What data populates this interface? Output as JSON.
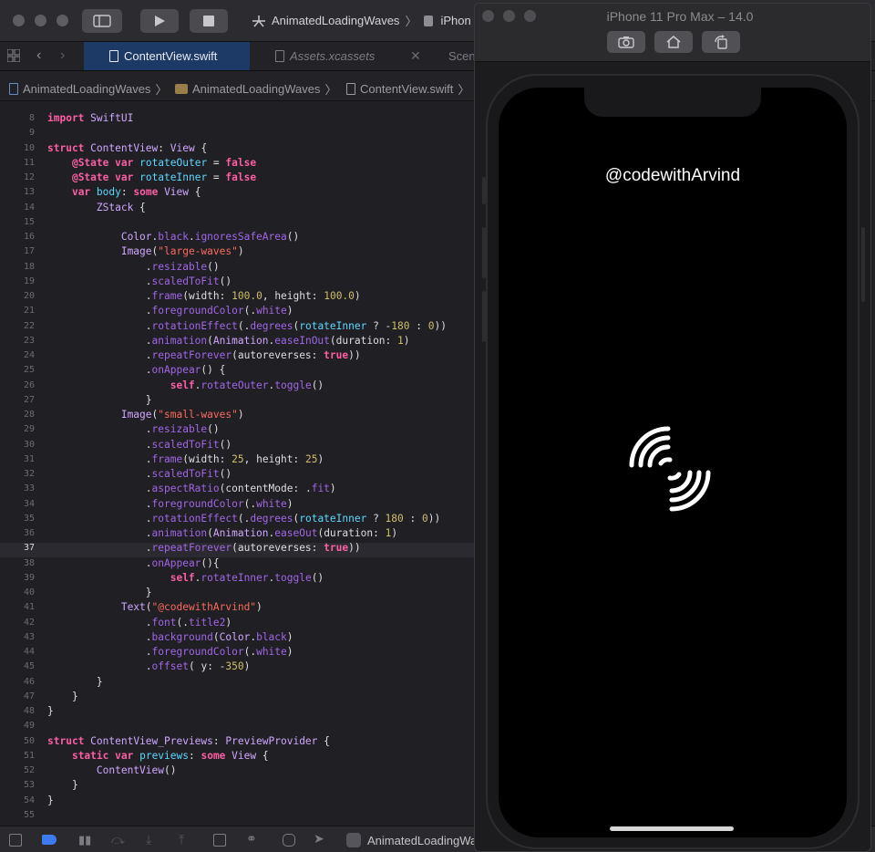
{
  "toolbar": {
    "scheme_project": "AnimatedLoadingWaves",
    "scheme_device": "iPhon"
  },
  "tabs": [
    {
      "label": "ContentView.swift",
      "active": true
    },
    {
      "label": "Assets.xcassets",
      "active": false
    },
    {
      "label": "Scen",
      "active": false
    }
  ],
  "breadcrumb": [
    "AnimatedLoadingWaves",
    "AnimatedLoadingWaves",
    "ContentView.swift"
  ],
  "editor": {
    "current_line": 37,
    "lines": [
      {
        "n": 8,
        "text": "import SwiftUI"
      },
      {
        "n": 9,
        "text": ""
      },
      {
        "n": 10,
        "text": "struct ContentView: View {"
      },
      {
        "n": 11,
        "text": "    @State var rotateOuter = false"
      },
      {
        "n": 12,
        "text": "    @State var rotateInner = false"
      },
      {
        "n": 13,
        "text": "    var body: some View {"
      },
      {
        "n": 14,
        "text": "        ZStack {"
      },
      {
        "n": 15,
        "text": ""
      },
      {
        "n": 16,
        "text": "            Color.black.ignoresSafeArea()"
      },
      {
        "n": 17,
        "text": "            Image(\"large-waves\")"
      },
      {
        "n": 18,
        "text": "                .resizable()"
      },
      {
        "n": 19,
        "text": "                .scaledToFit()"
      },
      {
        "n": 20,
        "text": "                .frame(width: 100.0, height: 100.0)"
      },
      {
        "n": 21,
        "text": "                .foregroundColor(.white)"
      },
      {
        "n": 22,
        "text": "                .rotationEffect(.degrees(rotateInner ? -180 : 0))"
      },
      {
        "n": 23,
        "text": "                .animation(Animation.easeInOut(duration: 1)"
      },
      {
        "n": 24,
        "text": "                .repeatForever(autoreverses: true))"
      },
      {
        "n": 25,
        "text": "                .onAppear() {"
      },
      {
        "n": 26,
        "text": "                    self.rotateOuter.toggle()"
      },
      {
        "n": 27,
        "text": "                }"
      },
      {
        "n": 28,
        "text": "            Image(\"small-waves\")"
      },
      {
        "n": 29,
        "text": "                .resizable()"
      },
      {
        "n": 30,
        "text": "                .scaledToFit()"
      },
      {
        "n": 31,
        "text": "                .frame(width: 25, height: 25)"
      },
      {
        "n": 32,
        "text": "                .scaledToFit()"
      },
      {
        "n": 33,
        "text": "                .aspectRatio(contentMode: .fit)"
      },
      {
        "n": 34,
        "text": "                .foregroundColor(.white)"
      },
      {
        "n": 35,
        "text": "                .rotationEffect(.degrees(rotateInner ? 180 : 0))"
      },
      {
        "n": 36,
        "text": "                .animation(Animation.easeOut(duration: 1)"
      },
      {
        "n": 37,
        "text": "                .repeatForever(autoreverses: true))"
      },
      {
        "n": 38,
        "text": "                .onAppear(){"
      },
      {
        "n": 39,
        "text": "                    self.rotateInner.toggle()"
      },
      {
        "n": 40,
        "text": "                }"
      },
      {
        "n": 41,
        "text": "            Text(\"@codewithArvind\")"
      },
      {
        "n": 42,
        "text": "                .font(.title2)"
      },
      {
        "n": 43,
        "text": "                .background(Color.black)"
      },
      {
        "n": 44,
        "text": "                .foregroundColor(.white)"
      },
      {
        "n": 45,
        "text": "                .offset( y: -350)"
      },
      {
        "n": 46,
        "text": "        }"
      },
      {
        "n": 47,
        "text": "    }"
      },
      {
        "n": 48,
        "text": "}"
      },
      {
        "n": 49,
        "text": ""
      },
      {
        "n": 50,
        "text": "struct ContentView_Previews: PreviewProvider {"
      },
      {
        "n": 51,
        "text": "    static var previews: some View {"
      },
      {
        "n": 52,
        "text": "        ContentView()"
      },
      {
        "n": 53,
        "text": "    }"
      },
      {
        "n": 54,
        "text": "}"
      },
      {
        "n": 55,
        "text": ""
      }
    ]
  },
  "bottombar": {
    "scheme_label": "AnimatedLoadingWaves"
  },
  "simulator": {
    "title": "iPhone 11 Pro Max – 14.0",
    "screen_text": "@codewithArvind"
  },
  "colors": {
    "keyword": "#fc5fa3",
    "type": "#d0a8ff",
    "string": "#fc6a5d",
    "number": "#d0bf69",
    "active_tab": "#1d3a66"
  }
}
